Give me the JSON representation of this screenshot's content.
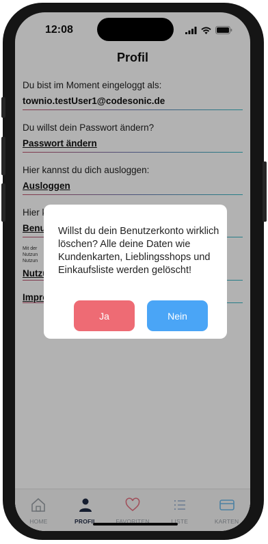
{
  "status_bar": {
    "time": "12:08"
  },
  "header": {
    "title": "Profil"
  },
  "sections": [
    {
      "label": "Du bist im Moment eingeloggt als:",
      "value": "townio.testUser1@codesonic.de"
    },
    {
      "label": "Du willst dein Passwort ändern?",
      "value": "Passwort ändern"
    },
    {
      "label": "Hier kannst du dich ausloggen:",
      "value": "Ausloggen"
    },
    {
      "label": "Hier k",
      "value": "Benu"
    },
    {
      "label": "Mit der\nNutzun\nNutzun",
      "value": "Nutzu"
    },
    {
      "label": "",
      "value": "Impre"
    }
  ],
  "dialog": {
    "message": "Willst du dein Benutzerkonto wirklich löschen? Alle deine Daten wie Kundenkarten, Lieblingsshops und Einkaufsliste werden gelöscht!",
    "confirm_label": "Ja",
    "cancel_label": "Nein"
  },
  "tabs": [
    {
      "label": "HOME",
      "icon": "home-icon",
      "active": false
    },
    {
      "label": "PROFIL",
      "icon": "person-icon",
      "active": true
    },
    {
      "label": "FAVORITEN",
      "icon": "heart-icon",
      "active": false
    },
    {
      "label": "LISTE",
      "icon": "list-icon",
      "active": false
    },
    {
      "label": "KARTEN",
      "icon": "card-icon",
      "active": false
    }
  ],
  "colors": {
    "confirm_button": "#ee6b74",
    "cancel_button": "#4aa5f6",
    "active_tab": "#1f2a44",
    "inactive_tab": "#9aa0a6"
  }
}
